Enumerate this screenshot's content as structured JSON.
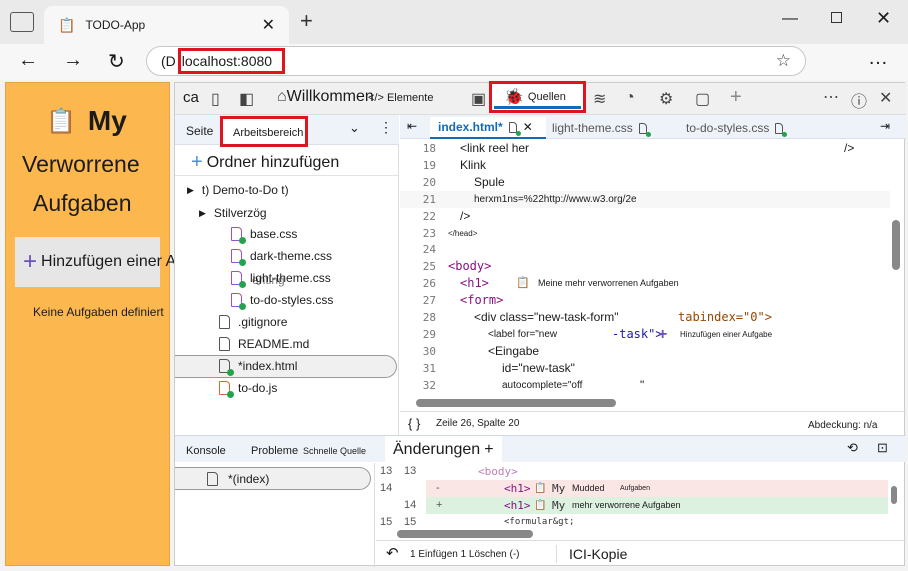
{
  "browser": {
    "tab_title": "TODO-App",
    "address": "localhost:8080",
    "address_prefix": "(D"
  },
  "page": {
    "title_my": "My",
    "title_line2": "Verworrene",
    "title_line3": "Aufgaben",
    "add_button": "Hinzufügen einer Aufgabe",
    "empty": "Keine Aufgaben definiert"
  },
  "devtools": {
    "tabs": {
      "first": "ca",
      "welcome": "Willkommen",
      "elements": "Elemente",
      "sources": "Quellen"
    },
    "nav": {
      "page": "Seite",
      "workspace": "Arbeitsbereich",
      "add_folder": "Ordner hinzufügen"
    },
    "tree": {
      "root": "t) Demo-to-Do t)",
      "styles": "Stilverzög",
      "files": [
        "base.css",
        "dark-theme.css",
        "light-theme.css",
        "to-do-styles.css"
      ],
      "overlay": "enting",
      "gitignore": ".gitignore",
      "readme": "README.md",
      "index": "*index.html",
      "todo": "to-do.js"
    },
    "editor_tabs": [
      "index.html*",
      "light-theme.css",
      "to-do-styles.css"
    ],
    "code": [
      {
        "n": "18",
        "t": "<link reel her",
        "end": "/>"
      },
      {
        "n": "19",
        "t": "Klink"
      },
      {
        "n": "20",
        "t": "Spule"
      },
      {
        "n": "21",
        "t": "herxm1ns=%22http://www.w3.org/2e"
      },
      {
        "n": "22",
        "t": "/>"
      },
      {
        "n": "23",
        "t": "</head>"
      },
      {
        "n": "24",
        "t": ""
      },
      {
        "n": "25",
        "t": "<body>"
      },
      {
        "n": "26",
        "t": "<h1>",
        "rest": "Meine mehr verworrenen Aufgaben"
      },
      {
        "n": "27",
        "t": "<form>"
      },
      {
        "n": "28",
        "t": "<div class=\"new-task-form\"",
        "rest": "tabindex=\"0\">"
      },
      {
        "n": "29",
        "t": "<label for=\"new",
        "rest": "-task\">",
        "rest2": "Hinzufügen einer Aufgabe"
      },
      {
        "n": "30",
        "t": "<Eingabe"
      },
      {
        "n": "31",
        "t": "id=\"new-task\""
      },
      {
        "n": "32",
        "t": "autocomplete=\"off",
        "rest": "\""
      }
    ],
    "status": {
      "position": "Zeile 26, Spalte 20",
      "coverage": "Abdeckung: n/a"
    },
    "drawer": {
      "console": "Konsole",
      "problems": "Probleme",
      "quick_source": "Schnelle Quelle",
      "changes": "Änderungen",
      "plus": "+",
      "file": "*(index)"
    },
    "diff": [
      {
        "a": "13",
        "b": "13",
        "sign": "",
        "t": "<body>"
      },
      {
        "a": "14",
        "b": "",
        "sign": "-",
        "t": "<h1>",
        "my": "My",
        "x": "Mudded",
        "y": "Aufgaben"
      },
      {
        "a": "",
        "b": "14",
        "sign": "+",
        "t": "<h1>",
        "my": "My",
        "x": "mehr verworrene Aufgaben"
      },
      {
        "a": "15",
        "b": "15",
        "sign": "",
        "t": "<formular&gt;"
      }
    ],
    "diff_status": {
      "summary": "1 Einfügen 1 Löschen (-)",
      "copy": "ICI-Kopie"
    }
  },
  "colors": {
    "accent": "#0f6cbd",
    "page_bg": "#fcb84f",
    "highlight": "#e0141e"
  }
}
